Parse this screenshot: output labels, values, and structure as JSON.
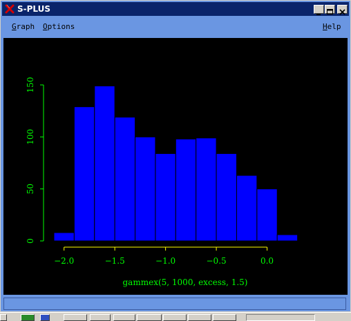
{
  "window": {
    "title": "S-PLUS",
    "icon": "splus-red-x-icon",
    "buttons": [
      "minimize-icon",
      "maximize-icon",
      "close-icon"
    ]
  },
  "menu": {
    "graph": {
      "label_underlined": "G",
      "label_rest": "raph"
    },
    "options": {
      "label_underlined": "O",
      "label_rest": "ptions"
    },
    "help": {
      "label_underlined": "H",
      "label_rest": "elp"
    }
  },
  "colors": {
    "plot_background": "#000000",
    "bars": "#0000ff",
    "bar_edges": "#000000",
    "axis_labels": "#00ff00",
    "axis_line": "#ffff00"
  },
  "taskbar": {
    "icons": [
      "start-icon",
      "app-icon",
      "ie-icon",
      "explorer-icon",
      "splus-icon",
      "check-icon",
      "check-icon",
      "check-icon",
      "splus-icon",
      "media-icon",
      "tray-icons"
    ]
  },
  "chart_data": {
    "type": "bar",
    "title": "",
    "xlabel": "gammex(5, 1000, excess, 1.5)",
    "ylabel": "",
    "bin_edges": [
      -2.1,
      -1.9,
      -1.7,
      -1.5,
      -1.3,
      -1.1,
      -0.9,
      -0.7,
      -0.5,
      -0.3,
      -0.1,
      0.1,
      0.3,
      0.5
    ],
    "values": [
      8,
      129,
      149,
      119,
      100,
      84,
      98,
      99,
      84,
      63,
      50,
      6
    ],
    "xlim": [
      -2.1,
      0.5
    ],
    "ylim": [
      0,
      150
    ],
    "xticks": [
      -2.0,
      -1.5,
      -1.0,
      -0.5,
      0.0
    ],
    "xtick_labels": [
      "−2.0",
      "−1.5",
      "−1.0",
      "−0.5",
      "0.0"
    ],
    "yticks": [
      0,
      50,
      100,
      150
    ],
    "ytick_labels": [
      "0",
      "50",
      "100",
      "150"
    ],
    "grid": false,
    "legend": "none"
  }
}
